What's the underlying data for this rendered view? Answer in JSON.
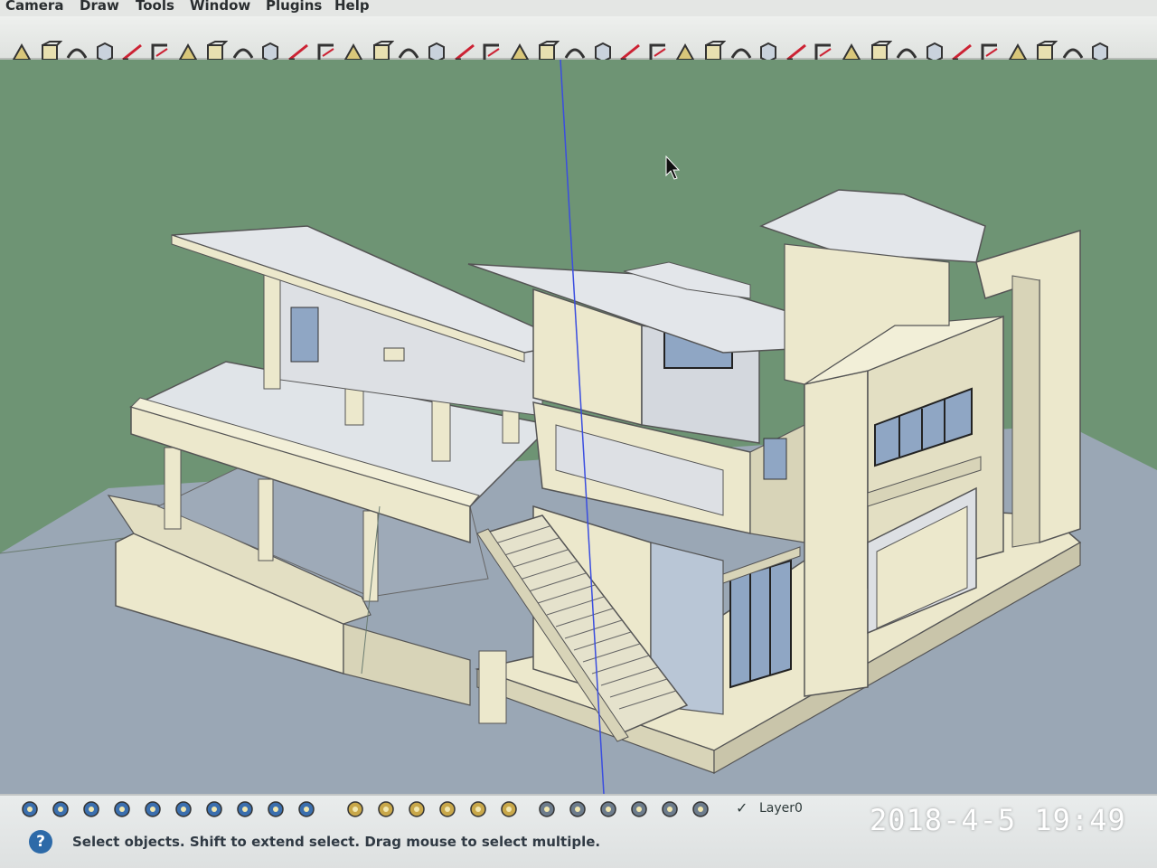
{
  "app": {
    "menu": [
      "Camera",
      "Draw",
      "Tools",
      "Window",
      "Plugins",
      "Help"
    ],
    "toolbar_icons": [
      "walk-icon",
      "look-around-icon",
      "position-camera-icon",
      "box-icon",
      "cube-icon",
      "sweep-icon",
      "arc-icon",
      "line-icon",
      "freehand-icon",
      "curve-icon",
      "extrude-icon",
      "sandbox-icon",
      "push-pull-icon",
      "shell-icon",
      "sphere-icon",
      "intersect-icon",
      "subtract-icon",
      "union-icon",
      "trim-icon",
      "split-icon",
      "fillet-icon",
      "chamfer-icon",
      "bend-icon",
      "twist-icon",
      "section-icon",
      "profile-icon",
      "door-icon",
      "window-icon",
      "stair-icon",
      "railing-icon",
      "wall-icon",
      "roof-icon",
      "floor-icon",
      "grid-icon",
      "column-icon",
      "beam-icon",
      "slab-icon",
      "hatch-icon",
      "dimension-icon",
      "render-icon"
    ]
  },
  "viewport": {
    "background_color": "#6e9474",
    "ground_color": "#9aa7b5",
    "model": "two-storey house model"
  },
  "statusbar": {
    "left_icons": [
      "geo-location-icon",
      "credits-icon",
      "license-icon",
      "measure-icon",
      "info-icon",
      "hide-icon",
      "components-icon",
      "materials-icon",
      "styles-icon",
      "scenes-icon"
    ],
    "mid_icons": [
      "ruler-icon",
      "pencil-icon",
      "tape-icon",
      "protractor-icon",
      "orbit-icon",
      "pan-icon"
    ],
    "layer_icons": [
      "layer-new-icon",
      "layer-delete-icon",
      "layer-house-icon",
      "layer-open-icon",
      "layer-home-icon",
      "layer-store-icon"
    ],
    "layer_check": "✓",
    "layer_name": "Layer0",
    "help_symbol": "?",
    "message": "Select objects. Shift to extend select. Drag mouse to select multiple."
  },
  "photo": {
    "timestamp": "2018-4-5 19:49"
  },
  "colors": {
    "accent": "#2d6aa8",
    "wall": "#ece8cc",
    "wall_shade": "#d8d4b8",
    "glass": "#8fa6c4",
    "axis_blue": "#3a4de0"
  }
}
